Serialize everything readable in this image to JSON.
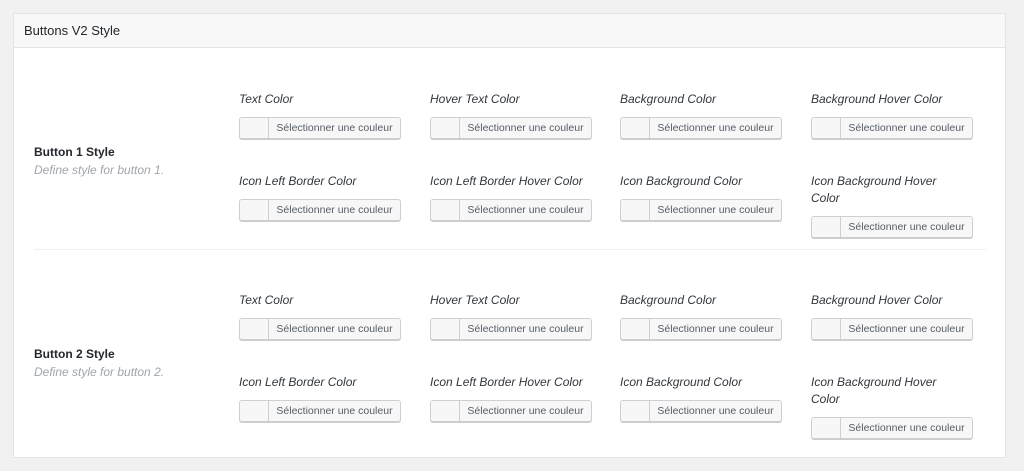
{
  "header": {
    "title": "Buttons V2 Style"
  },
  "picker_label": "Sélectionner une couleur",
  "sections": [
    {
      "title": "Button 1 Style",
      "description": "Define style for button 1.",
      "fields": [
        "Text Color",
        "Hover Text Color",
        "Background Color",
        "Background Hover Color",
        "Icon Left Border Color",
        "Icon Left Border Hover Color",
        "Icon Background Color",
        "Icon Background Hover Color"
      ]
    },
    {
      "title": "Button 2 Style",
      "description": "Define style for button 2.",
      "fields": [
        "Text Color",
        "Hover Text Color",
        "Background Color",
        "Background Hover Color",
        "Icon Left Border Color",
        "Icon Left Border Hover Color",
        "Icon Background Color",
        "Icon Background Hover Color"
      ]
    }
  ]
}
